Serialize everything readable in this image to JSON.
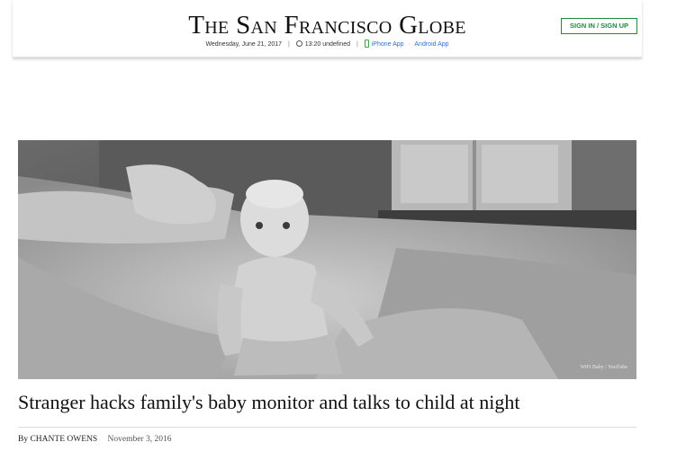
{
  "header": {
    "site_title": "The San Francisco Globe",
    "date": "Wednesday, June 21, 2017",
    "time": "13:20 undefined",
    "iphone_app": "iPhone App",
    "android_app": "Android App",
    "signin_label": "SIGN IN / SIGN UP"
  },
  "article": {
    "image_credit": "WiFi Baby / YouTube",
    "headline": "Stranger hacks family's baby monitor and talks to child at night",
    "byline_prefix": "By",
    "author": "CHANTE OWENS",
    "date": "November 3, 2016"
  },
  "colors": {
    "accent_green": "#1f8a3b",
    "link_blue": "#2f6fd8"
  }
}
